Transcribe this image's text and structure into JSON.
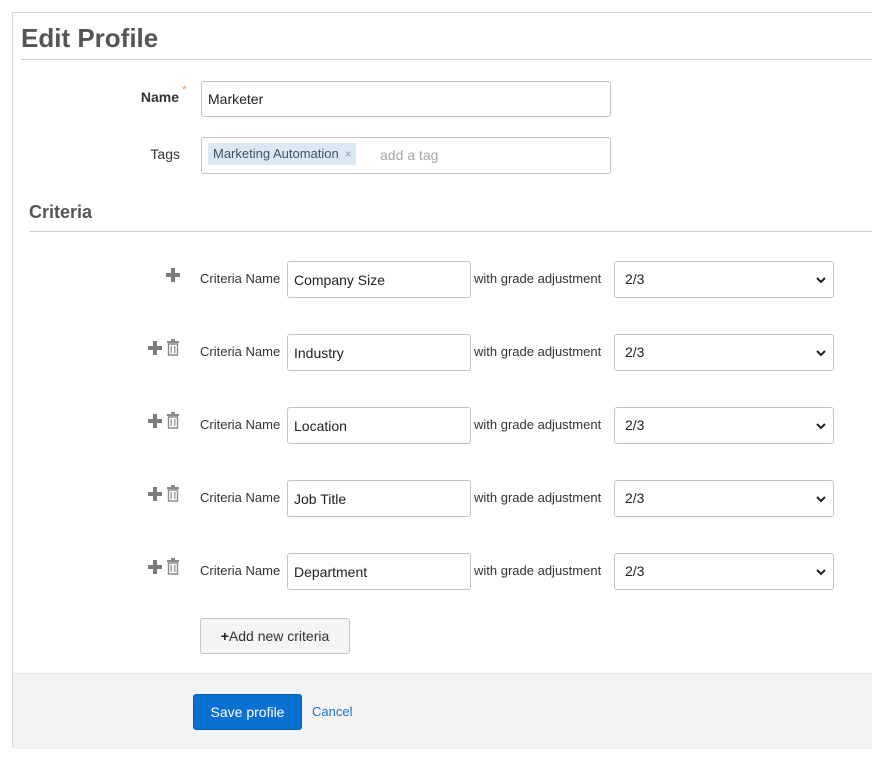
{
  "page": {
    "title": "Edit Profile"
  },
  "form": {
    "name_label": "Name",
    "required_mark": "*",
    "name_value": "Marketer",
    "tags_label": "Tags",
    "tags": [
      {
        "label": "Marketing Automation",
        "remove": "×"
      }
    ],
    "tag_placeholder": "add a tag"
  },
  "criteria": {
    "section_title": "Criteria",
    "name_label": "Criteria Name",
    "grade_label": "with grade adjustment",
    "rows": [
      {
        "name": "Company Size",
        "grade": "2/3",
        "deletable": false
      },
      {
        "name": "Industry",
        "grade": "2/3",
        "deletable": true
      },
      {
        "name": "Location",
        "grade": "2/3",
        "deletable": true
      },
      {
        "name": "Job Title",
        "grade": "2/3",
        "deletable": true
      },
      {
        "name": "Department",
        "grade": "2/3",
        "deletable": true
      }
    ],
    "add_button_label": "Add new criteria"
  },
  "footer": {
    "save_label": "Save profile",
    "cancel_label": "Cancel"
  },
  "colors": {
    "primary": "#0a70d1",
    "tag_bg": "#dbe9f3",
    "required": "#e8a33a"
  }
}
